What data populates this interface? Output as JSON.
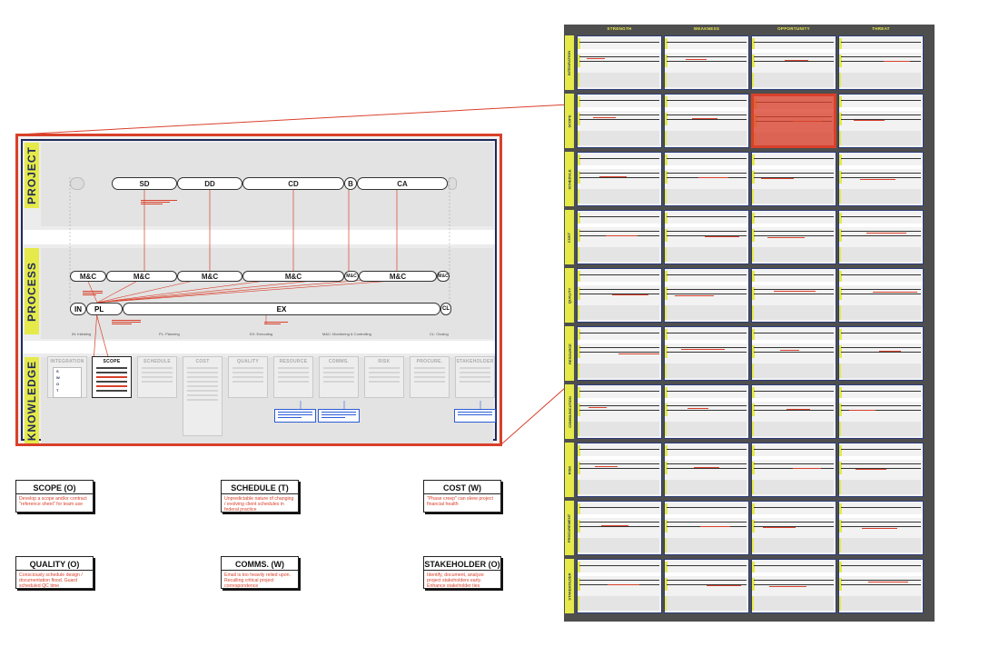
{
  "detail": {
    "bands": {
      "project": "PROJECT",
      "process": "PROCESS",
      "knowledge": "KNOWLEDGE"
    },
    "project_phases": [
      "SD",
      "DD",
      "CD",
      "B",
      "CA"
    ],
    "mc_labels": [
      "M&C",
      "M&C",
      "M&C",
      "M&C",
      "M&C",
      "M&C",
      "M&C"
    ],
    "process_steps": [
      "IN",
      "PL",
      "EX",
      "CL"
    ],
    "step_legend": [
      "IN: Initiating",
      "PL: Planning",
      "EX: Executing",
      "M&C: Monitoring & Controlling",
      "CL: Closing"
    ],
    "knowledge_areas": [
      "INTEGRATION",
      "SCOPE",
      "SCHEDULE",
      "COST",
      "QUALITY",
      "RESOURCE",
      "COMMS.",
      "RISK",
      "PROCURE.",
      "STAKEHOLDER"
    ],
    "swot_letters": [
      "S",
      "W",
      "O",
      "T"
    ]
  },
  "cards": [
    {
      "title": "SCOPE (O)",
      "body": "Develop a scope and/or contract \"reference sheet\" for team use"
    },
    {
      "title": "SCHEDULE (T)",
      "body": "Unpredictable nature of changing / evolving client schedules in federal practice"
    },
    {
      "title": "COST (W)",
      "body": "\"Phase creep\" can skew project financial health"
    },
    {
      "title": "QUALITY (O)",
      "body": "Consciously schedule design / documentation flood. Guard scheduled QC time"
    },
    {
      "title": "COMMS. (W)",
      "body": "Email is too heavily relied upon. Recalling critical project correspondence"
    },
    {
      "title": "STAKEHOLDER (O)",
      "body": "Identify, document, analyze project stakeholders early. Enhance stakeholder ties"
    }
  ],
  "matrix": {
    "columns": [
      "STRENGTH",
      "WEAKNESS",
      "OPPORTUNITY",
      "THREAT"
    ],
    "rows": [
      "INTEGRATION",
      "SCOPE",
      "SCHEDULE",
      "COST",
      "QUALITY",
      "RESOURCE",
      "COMMUNICATION",
      "RISK",
      "PROCUREMENT",
      "STAKEHOLDER"
    ],
    "highlight": {
      "row": "SCOPE",
      "column": "OPPORTUNITY"
    }
  },
  "colors": {
    "accent_red": "#d9402b",
    "band_yellow": "#e5ea4a",
    "navy": "#1f2a5a",
    "matrix_bg": "#4e4e4e",
    "link_blue": "#2b5cd8"
  }
}
